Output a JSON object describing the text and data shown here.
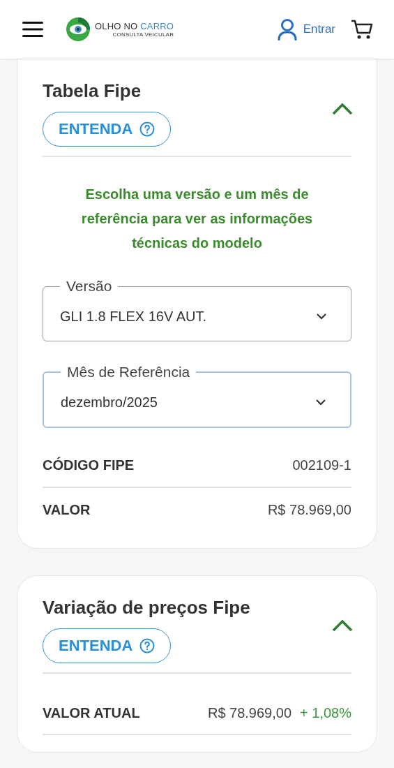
{
  "header": {
    "brand": [
      {
        "text": "OLHO NO",
        "highlight": false
      },
      {
        "text": "CARRO",
        "highlight": true
      }
    ],
    "tagline": "CONSULTA VEICULAR",
    "login": "Entrar"
  },
  "cards": [
    {
      "title": "Tabela Fipe",
      "expanded": true,
      "help_button": "ENTENDA",
      "message": "Escolha uma versão e um mês de referência para ver as informações técnicas do modelo",
      "selects": [
        {
          "label": "Versão",
          "value": "GLI 1.8 FLEX 16V AUT.",
          "focused": false
        },
        {
          "label": "Mês de Referência",
          "value": "dezembro/2025",
          "focused": true
        }
      ],
      "rows": [
        {
          "label": "CÓDIGO FIPE",
          "value": "002109-1"
        },
        {
          "label": "VALOR",
          "value": "R$ 78.969,00"
        }
      ]
    },
    {
      "title": "Variação de preços Fipe",
      "expanded": true,
      "help_button": "ENTENDA",
      "rows": [
        {
          "label": "VALOR ATUAL",
          "value": "R$ 78.969,00",
          "change": "+ 1,08%"
        }
      ]
    }
  ]
}
